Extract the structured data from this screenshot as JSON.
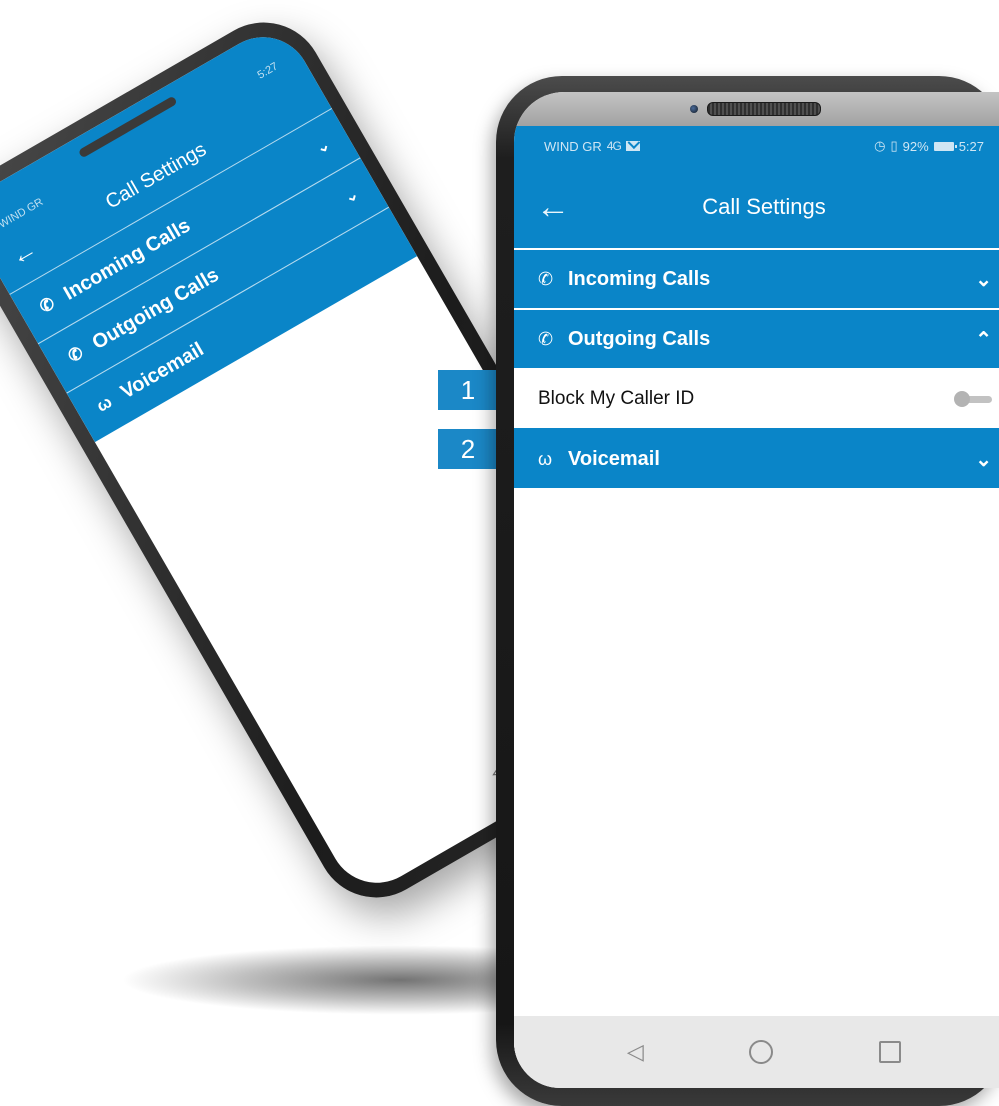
{
  "status": {
    "carrier": "WIND GR",
    "signal": "4G",
    "battery_percent": "92%",
    "time": "5:27"
  },
  "header": {
    "title": "Call Settings",
    "back_glyph": "←"
  },
  "sections": [
    {
      "label": "Incoming Calls",
      "icon": "incoming-call-icon",
      "glyph": "✆",
      "expanded": false,
      "chevron": "⌄"
    },
    {
      "label": "Outgoing Calls",
      "icon": "outgoing-call-icon",
      "glyph": "✆",
      "expanded": true,
      "chevron": "⌃"
    },
    {
      "label": "Voicemail",
      "icon": "voicemail-icon",
      "glyph": "ω",
      "expanded": false,
      "chevron": "⌄"
    }
  ],
  "outgoing_settings": {
    "block_caller_id": {
      "label": "Block My Caller ID",
      "enabled": false
    }
  },
  "steps": [
    "1",
    "2"
  ],
  "nav": {
    "back": "◁"
  },
  "colors": {
    "primary": "#0a85c8",
    "badge": "#1b88c7"
  }
}
